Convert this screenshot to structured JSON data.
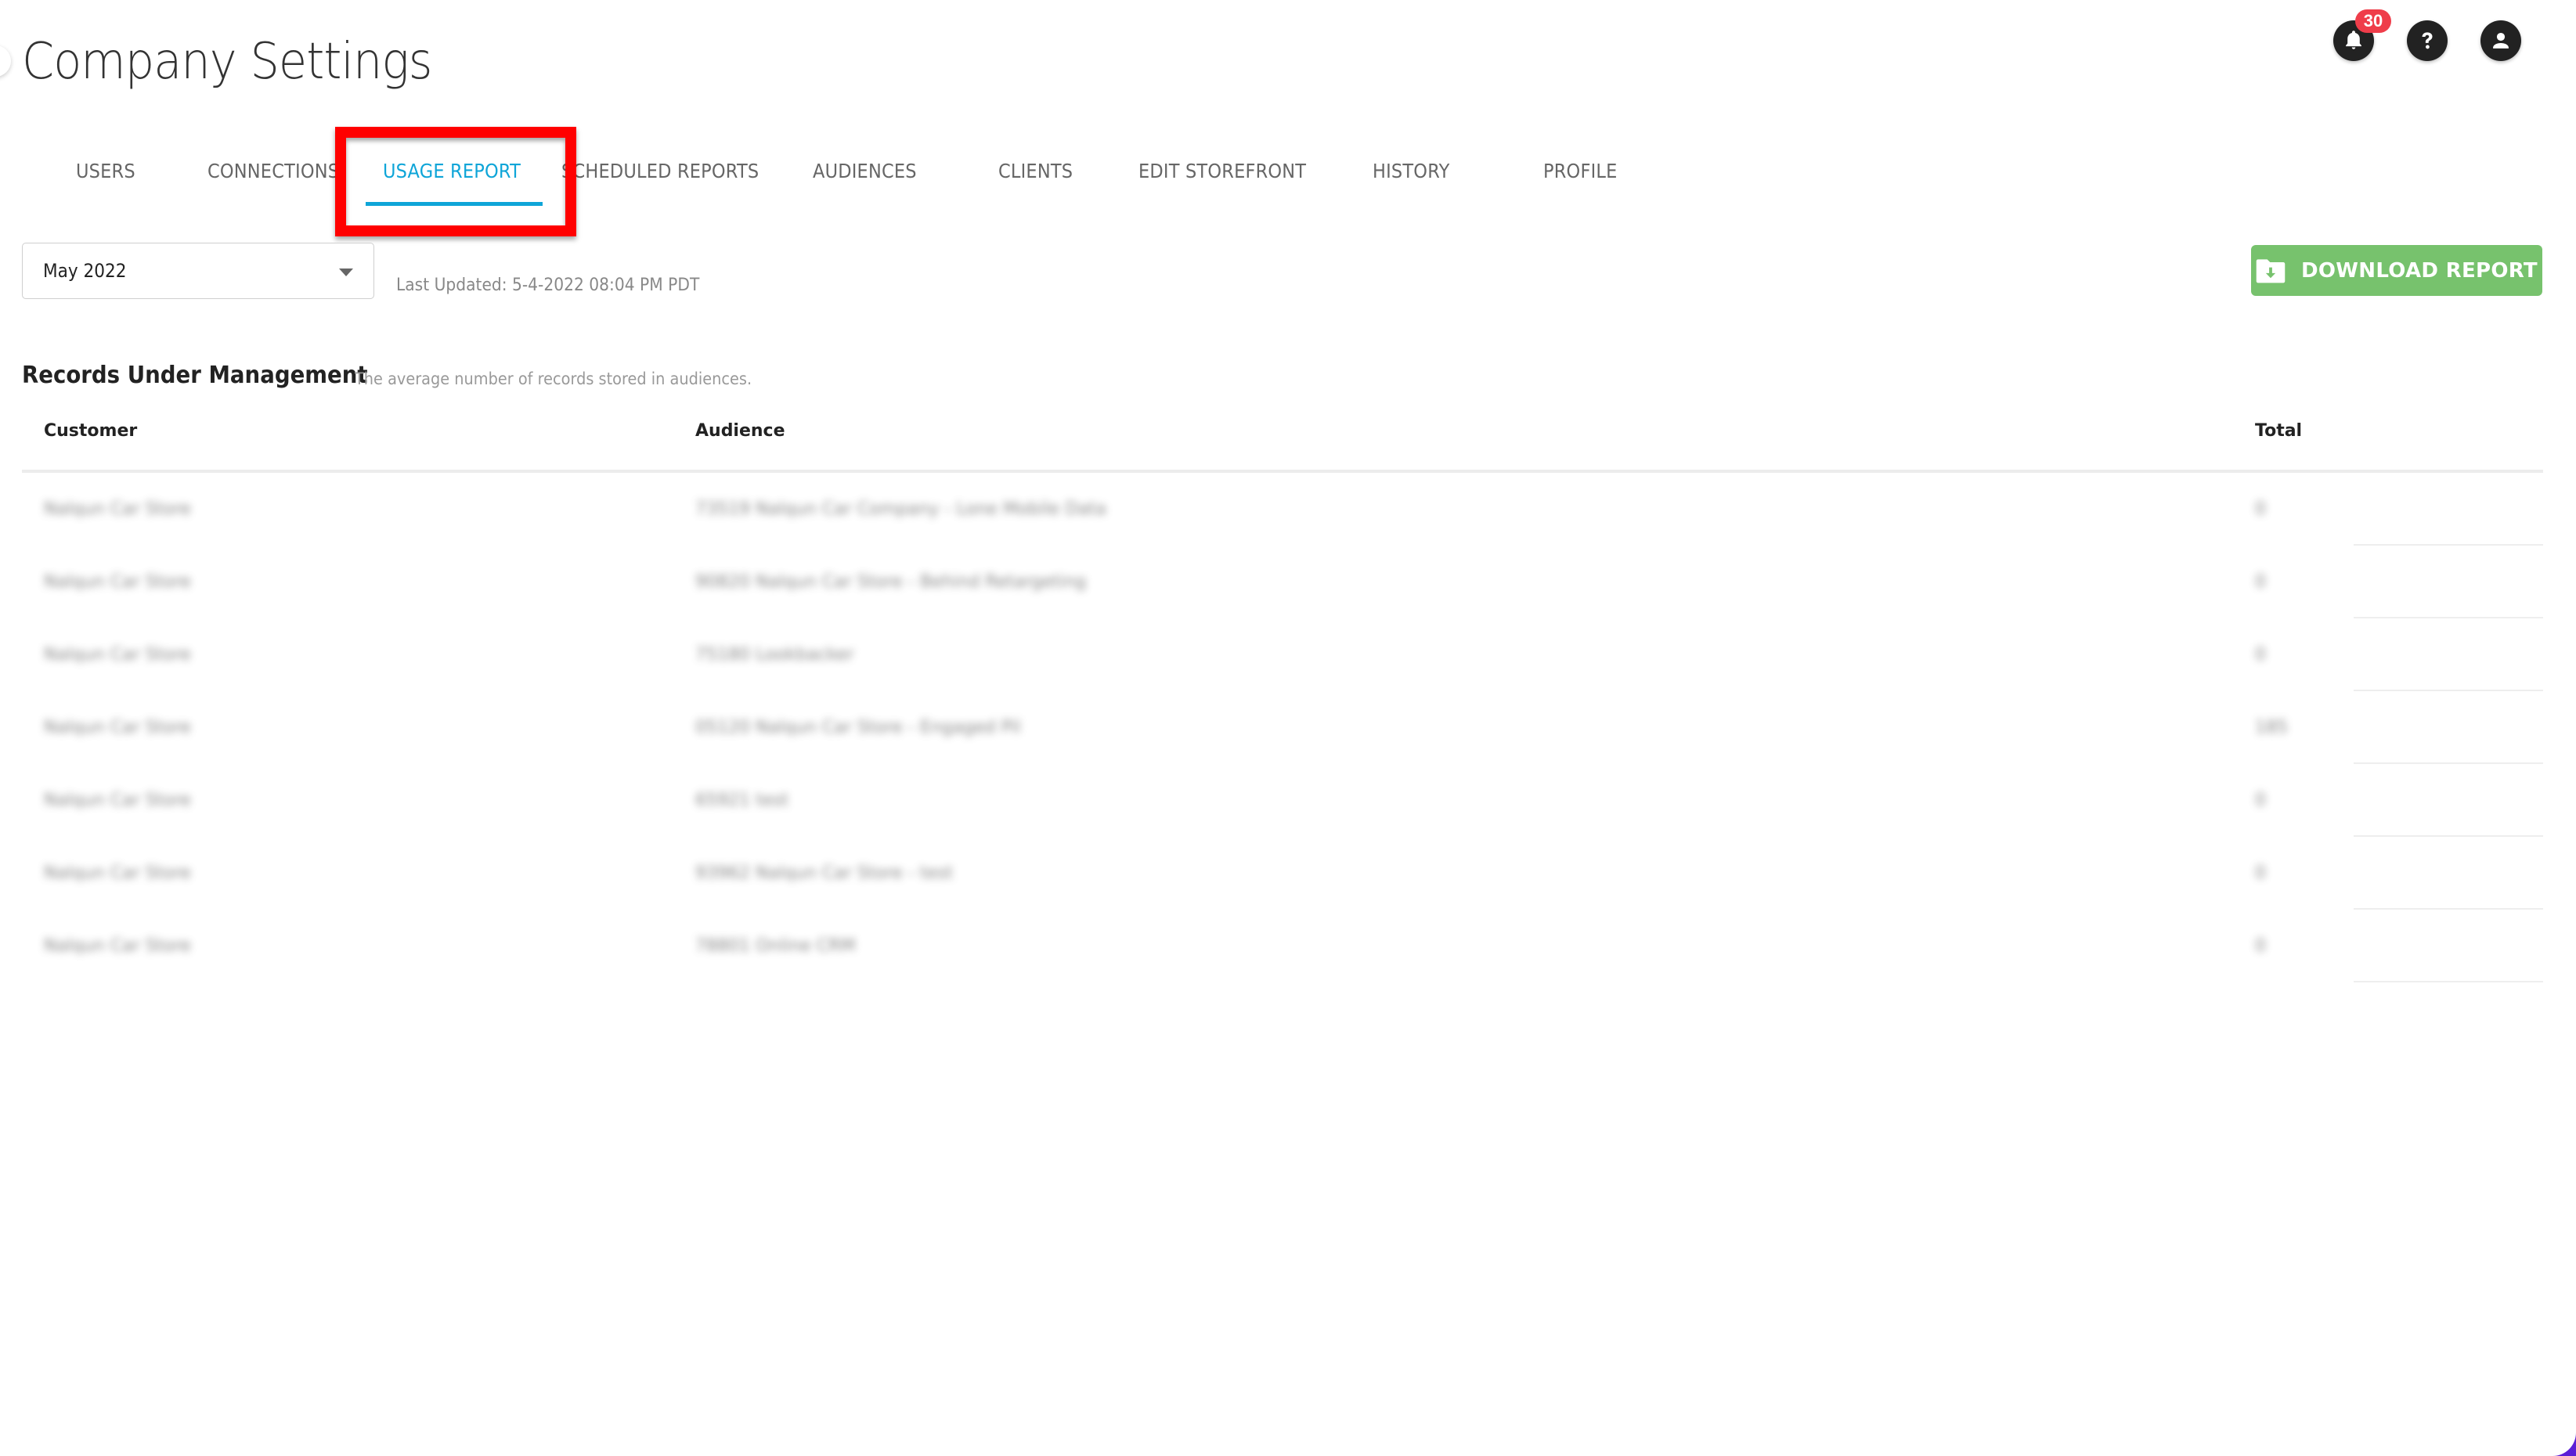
{
  "header": {
    "title": "Company Settings",
    "notification_count": "30",
    "icons": [
      "bell-icon",
      "help-icon",
      "user-account-icon"
    ]
  },
  "tabs": [
    {
      "label": "USERS",
      "active": false
    },
    {
      "label": "CONNECTIONS",
      "active": false
    },
    {
      "label": "USAGE REPORT",
      "active": true
    },
    {
      "label": "SCHEDULED REPORTS",
      "active": false
    },
    {
      "label": "AUDIENCES",
      "active": false
    },
    {
      "label": "CLIENTS",
      "active": false
    },
    {
      "label": "EDIT STOREFRONT",
      "active": false
    },
    {
      "label": "HISTORY",
      "active": false
    },
    {
      "label": "PROFILE",
      "active": false
    }
  ],
  "colors": {
    "accent": "#0ea5d8",
    "download_button": "#77c26d",
    "badge": "#ef3d4a",
    "highlight": "#ff0000"
  },
  "toolbar": {
    "month_select_value": "May 2022",
    "last_updated": "Last Updated: 5-4-2022 08:04 PM PDT",
    "download_label": "DOWNLOAD REPORT"
  },
  "section": {
    "title": "Records Under Management",
    "description": "The average number of records stored in audiences."
  },
  "table": {
    "columns": [
      "Customer",
      "Audience",
      "Total"
    ],
    "rows": [
      {
        "customer": "Nalqun Car Store",
        "audience": "73519 Nalqun Car Company - Lone Mobile Data",
        "total": "0"
      },
      {
        "customer": "Nalqun Car Store",
        "audience": "90820 Nalqun Car Store - Behind Retargeting",
        "total": "0"
      },
      {
        "customer": "Nalqun Car Store",
        "audience": "75180 Lookbacker",
        "total": "0"
      },
      {
        "customer": "Nalqun Car Store",
        "audience": "05120 Nalqun Car Store - Engaged Pil",
        "total": "185"
      },
      {
        "customer": "Nalqun Car Store",
        "audience": "65921 test",
        "total": "0"
      },
      {
        "customer": "Nalqun Car Store",
        "audience": "93962 Nalqun Car Store - test",
        "total": "0"
      },
      {
        "customer": "Nalqun Car Store",
        "audience": "78801 Online CRM",
        "total": "0"
      }
    ]
  }
}
